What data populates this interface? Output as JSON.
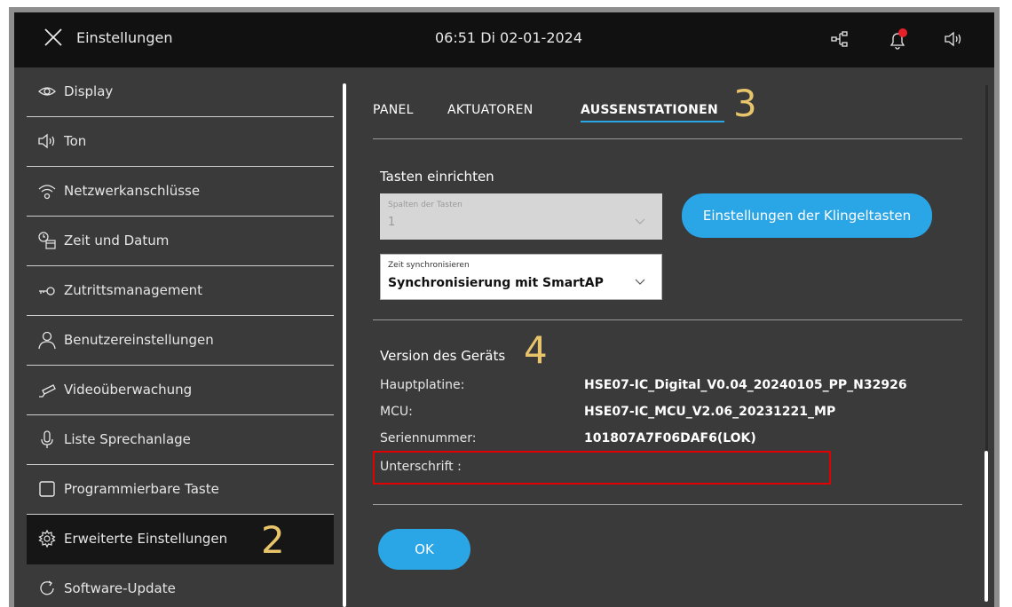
{
  "topbar": {
    "title": "Einstellungen",
    "clock": "06:51  Di 02-01-2024"
  },
  "sidebar": {
    "items": [
      {
        "label": "Display",
        "icon": "eye-icon"
      },
      {
        "label": "Ton",
        "icon": "speaker-icon"
      },
      {
        "label": "Netzwerkanschlüsse",
        "icon": "wifi-icon"
      },
      {
        "label": "Zeit und Datum",
        "icon": "clock-calendar-icon"
      },
      {
        "label": "Zutrittsmanagement",
        "icon": "key-icon"
      },
      {
        "label": "Benutzereinstellungen",
        "icon": "user-icon"
      },
      {
        "label": "Videoüberwachung",
        "icon": "camera-icon"
      },
      {
        "label": "Liste Sprechanlage",
        "icon": "microphone-icon"
      },
      {
        "label": "Programmierbare Taste",
        "icon": "square-icon"
      },
      {
        "label": "Erweiterte Einstellungen",
        "icon": "gear-icon"
      },
      {
        "label": "Software-Update",
        "icon": "refresh-icon"
      }
    ],
    "active_index": 9
  },
  "tabs": [
    {
      "label": "PANEL"
    },
    {
      "label": "AKTUATOREN"
    },
    {
      "label": "AUSSENSTATIONEN"
    }
  ],
  "annotations": {
    "step2": "2",
    "step3": "3",
    "step4": "4"
  },
  "keys_section": {
    "title": "Tasten einrichten",
    "columns_dropdown": {
      "label": "Spalten der Tasten",
      "value": "1"
    },
    "doorbell_button": "Einstellungen der Klingeltasten",
    "time_sync_dropdown": {
      "label": "Zeit synchronisieren",
      "value": "Synchronisierung mit SmartAP"
    }
  },
  "version_section": {
    "title": "Version des Geräts",
    "rows": [
      {
        "label": "Hauptplatine:",
        "value": "HSE07-IC_Digital_V0.04_20240105_PP_N32926"
      },
      {
        "label": "MCU:",
        "value": "HSE07-IC_MCU_V2.06_20231221_MP"
      },
      {
        "label": "Seriennummer:",
        "value": "101807A7F06DAF6(LOK)"
      },
      {
        "label": "Unterschrift :",
        "value": ""
      }
    ]
  },
  "ok_button": "OK",
  "colors": {
    "accent": "#2aa5e6",
    "highlight_box": "#e00000",
    "annotation": "#e8c46a",
    "notification_dot": "#e8202a"
  }
}
